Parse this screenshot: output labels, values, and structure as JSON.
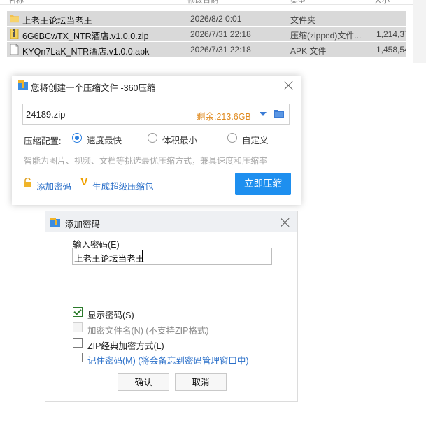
{
  "explorer": {
    "columns": [
      "名称",
      "修改日期",
      "类型",
      "大小"
    ],
    "rows": [
      {
        "name": "上老王论坛当老王",
        "date": "2026/8/2 0:01",
        "type": "文件夹",
        "size": "",
        "icon": "folder-icon"
      },
      {
        "name": "6G6BCwTX_NTR酒店.v1.0.0.zip",
        "date": "2026/7/31 22:18",
        "type": "压缩(zipped)文件...",
        "size": "1,214,37",
        "icon": "zip-icon"
      },
      {
        "name": "KYQn7LaK_NTR酒店.v1.0.0.apk",
        "date": "2026/7/31 22:18",
        "type": "APK 文件",
        "size": "1,458,54",
        "icon": "file-icon"
      }
    ]
  },
  "compress_dialog": {
    "title": "您将创建一个压缩文件 -360压缩",
    "filename": "24189.zip",
    "remaining": "剩余:213.6GB",
    "config_label": "压缩配置:",
    "options": [
      {
        "label": "速度最快",
        "selected": true
      },
      {
        "label": "体积最小",
        "selected": false
      },
      {
        "label": "自定义",
        "selected": false
      }
    ],
    "hint": "智能为图片、视频、文档等挑选最优压缩方式，兼具速度和压缩率",
    "add_password_link": "添加密码",
    "super_link": "生成超级压缩包",
    "compress_button": "立即压缩"
  },
  "password_dialog": {
    "title": "添加密码",
    "input_label": "输入密码(E)",
    "password_value": "上老王论坛当老王",
    "checkboxes": [
      {
        "label": "显示密码(S)",
        "checked": true,
        "disabled": false
      },
      {
        "label": "加密文件名(N) (不支持ZIP格式)",
        "checked": false,
        "disabled": true
      },
      {
        "label": "ZIP经典加密方式(L)",
        "checked": false,
        "disabled": false
      },
      {
        "label": "记住密码(M) (将会备忘到密码管理窗口中)",
        "checked": false,
        "disabled": false
      }
    ],
    "ok_label": "确认",
    "cancel_label": "取消"
  },
  "colors": {
    "accent_blue": "#1e8fef",
    "link_blue": "#2a6fc9",
    "remaining_orange": "#e08a1e",
    "row_selected": "#d9d9d9"
  }
}
